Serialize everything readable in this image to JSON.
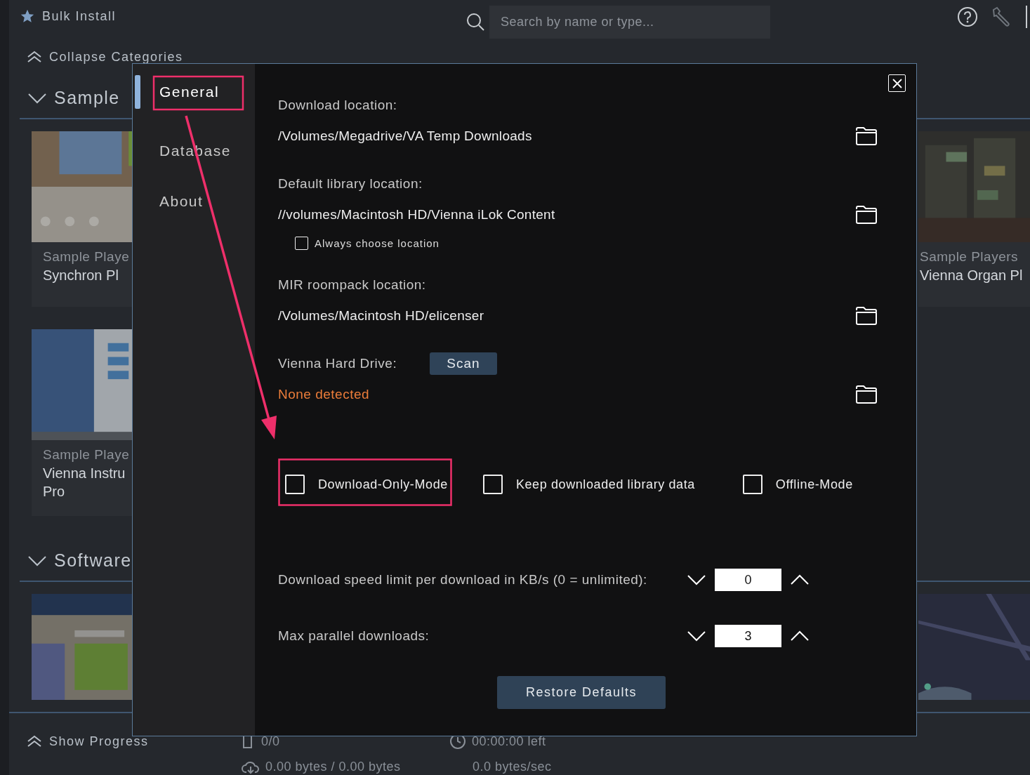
{
  "app": {
    "title": "Bulk Install",
    "search": {
      "placeholder": "Search by name or type..."
    },
    "collapse_label": "Collapse Categories"
  },
  "categories": [
    {
      "title": "Sample",
      "expanded": true,
      "cards": [
        {
          "kind": "picture",
          "subtitle": "Sample Playe",
          "title_lines": [
            "Synchron Pl"
          ]
        },
        {
          "kind": "picture",
          "subtitle": "Sample Players",
          "title_lines": [
            "Vienna Organ Pl"
          ]
        },
        {
          "kind": "picture",
          "subtitle": "Sample Playe",
          "title_lines": [
            "Vienna Instru",
            "Pro"
          ]
        }
      ]
    },
    {
      "title": "Software",
      "expanded": true
    }
  ],
  "progress": {
    "toggle_label": "Show Progress",
    "count": "0/0",
    "time_left": "00:00:00 left",
    "transferred": "0.00 bytes / 0.00 bytes",
    "rate": "0.0 bytes/sec"
  },
  "settings": {
    "nav": [
      {
        "label": "General",
        "selected": true
      },
      {
        "label": "Database",
        "selected": false
      },
      {
        "label": "About",
        "selected": false
      }
    ],
    "locations": [
      {
        "label": "Download location:",
        "path": "/Volumes/Megadrive/VA Temp Downloads"
      },
      {
        "label": "Default library location:",
        "path": "//volumes/Macintosh HD/Vienna iLok Content",
        "option": {
          "label": "Always choose location",
          "checked": false
        }
      },
      {
        "label": "MIR roompack location:",
        "path": "/Volumes/Macintosh HD/elicenser"
      }
    ],
    "hard_drive": {
      "label": "Vienna Hard Drive:",
      "scan_button": "Scan",
      "status": "None detected"
    },
    "modes": [
      {
        "label": "Download-Only-Mode",
        "checked": false
      },
      {
        "label": "Keep downloaded library data",
        "checked": false
      },
      {
        "label": "Offline-Mode",
        "checked": false
      }
    ],
    "steppers": [
      {
        "label": "Download speed limit per download in KB/s (0 = unlimited):",
        "value": "0"
      },
      {
        "label": "Max parallel downloads:",
        "value": "3"
      }
    ],
    "restore_button": "Restore Defaults"
  }
}
